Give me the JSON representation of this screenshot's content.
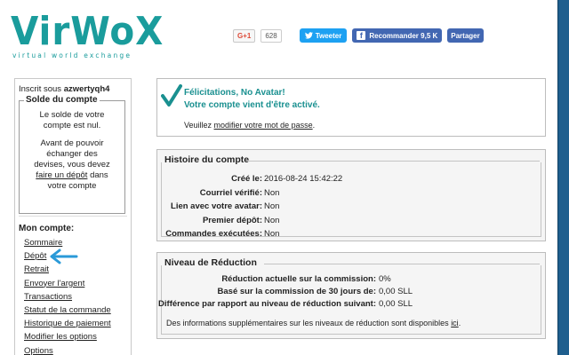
{
  "logo": {
    "wordmark": "VirWoX",
    "tagline": "virtual world exchange"
  },
  "social": {
    "gplus_label": "G+1",
    "gplus_count": "628",
    "tweet_label": "Tweeter",
    "fb_label": "Recommander 9,5 K",
    "fb_share_label": "Partager",
    "colors": {
      "twitter": "#1da1f2",
      "facebook": "#4267b2",
      "gplus": "#dd4b39"
    }
  },
  "sidebar": {
    "signed_in_prefix": "Inscrit sous",
    "username": "azwertyqh4",
    "balance_title": "Solde du compte",
    "balance_line1": "Le solde de votre",
    "balance_line2": "compte est nul.",
    "balance_line3": "Avant de pouvoir",
    "balance_line4": "échanger des",
    "balance_line5": "devises, vous devez",
    "balance_link": "faire un dépôt",
    "balance_line6_suffix": "dans",
    "balance_line7": "votre compte",
    "account_title": "Mon compte:",
    "links": [
      "Sommaire",
      "Dépôt",
      "Retrait",
      "Envoyer l'argent",
      "Transactions",
      "Statut de la commande",
      "Historique de paiement",
      "Modifier les options",
      "Options"
    ]
  },
  "welcome": {
    "title_line1": "Félicitations, No Avatar!",
    "title_line2": "Votre compte vient d'être activé.",
    "note_prefix": "Veuillez",
    "note_link": "modifier votre mot de passe",
    "note_suffix": ".",
    "accent": "#1a9090"
  },
  "history": {
    "title": "Histoire du compte",
    "rows": [
      {
        "label": "Créé le:",
        "value": "2016-08-24 15:42:22"
      },
      {
        "label": "Courriel vérifié:",
        "value": "Non"
      },
      {
        "label": "Lien avec votre avatar:",
        "value": "Non"
      },
      {
        "label": "Premier dépôt:",
        "value": "Non"
      },
      {
        "label": "Commandes exécutées:",
        "value": "Non"
      }
    ]
  },
  "reduction": {
    "title": "Niveau de Réduction",
    "rows": [
      {
        "label": "Réduction actuelle sur la commission:",
        "value": "0%"
      },
      {
        "label": "Basé sur la commission de 30 jours de:",
        "value": "0,00 SLL"
      },
      {
        "label": "Différence par rapport au niveau de réduction suivant:",
        "value": "0,00 SLL"
      }
    ],
    "footer_text": "Des informations supplémentaires sur les niveaux de réduction sont disponibles",
    "footer_link": "ici",
    "footer_suffix": "."
  }
}
